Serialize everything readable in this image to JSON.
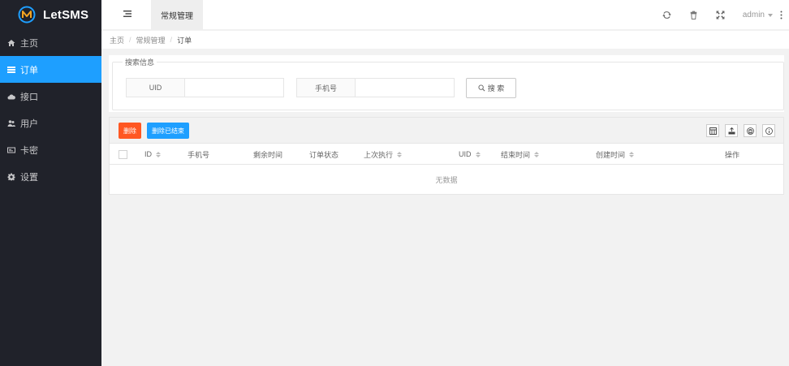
{
  "app": {
    "name": "LetSMS"
  },
  "sidebar": {
    "items": [
      {
        "label": "主页",
        "icon": "home-icon"
      },
      {
        "label": "订单",
        "icon": "list-icon",
        "active": true
      },
      {
        "label": "接口",
        "icon": "cloud-icon"
      },
      {
        "label": "用户",
        "icon": "users-icon"
      },
      {
        "label": "卡密",
        "icon": "card-icon"
      },
      {
        "label": "设置",
        "icon": "gear-icon"
      }
    ]
  },
  "header": {
    "active_tab": "常规管理",
    "user": "admin"
  },
  "breadcrumb": {
    "items": [
      "主页",
      "常规管理",
      "订单"
    ]
  },
  "search": {
    "legend": "搜索信息",
    "uid_label": "UID",
    "phone_label": "手机号",
    "button": "搜 索"
  },
  "toolbar": {
    "delete": "删除",
    "delete_ended": "删除已结束"
  },
  "table": {
    "columns": [
      "ID",
      "手机号",
      "剩余时间",
      "订单状态",
      "上次执行",
      "UID",
      "结束时间",
      "创建时间",
      "操作"
    ],
    "empty_text": "无数据"
  },
  "colors": {
    "sidebar_bg": "#20222a",
    "accent": "#1e9fff",
    "danger": "#ff5722"
  }
}
